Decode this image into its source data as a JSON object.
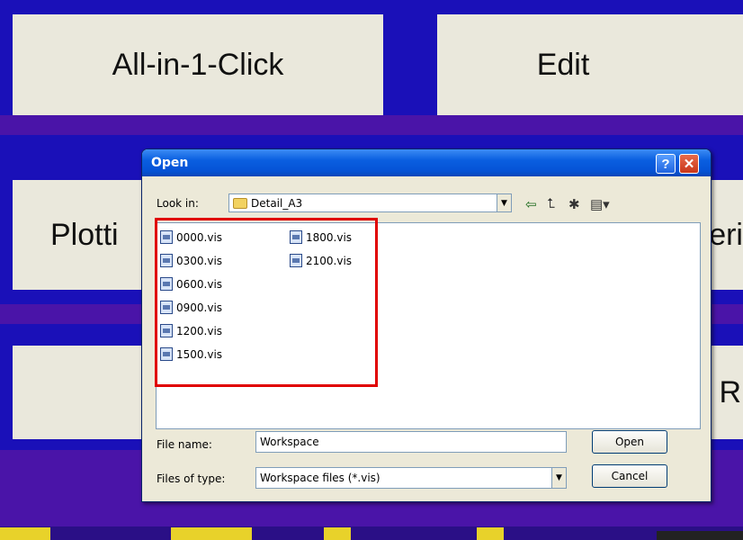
{
  "background_app": {
    "tiles": [
      "All-in-1-Click",
      "Edit",
      "Plotti",
      "eri",
      "R"
    ]
  },
  "dialog": {
    "title": "Open",
    "help_button": "?",
    "close_button": "✕",
    "look_in_label": "Look in:",
    "look_in_value": "Detail_A3",
    "files": [
      "0000.vis",
      "0300.vis",
      "0600.vis",
      "0900.vis",
      "1200.vis",
      "1500.vis",
      "1800.vis",
      "2100.vis"
    ],
    "file_name_label": "File name:",
    "file_name_value": "Workspace",
    "files_of_type_label": "Files of type:",
    "files_of_type_value": "Workspace files (*.vis)",
    "open_button": "Open",
    "cancel_button": "Cancel"
  },
  "colors": {
    "background_blue": "#1a10b8",
    "band_purple": "#4a14a8",
    "highlight_red": "#e00000"
  }
}
